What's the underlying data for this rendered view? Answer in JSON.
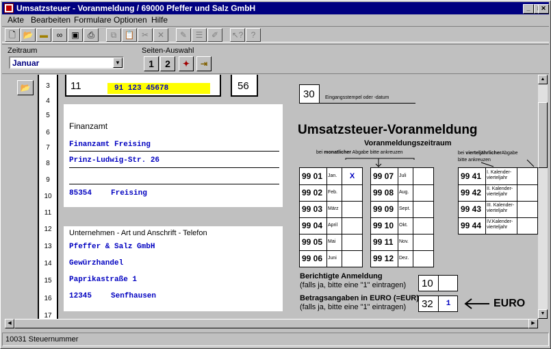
{
  "window": {
    "title": "Umsatzsteuer - Voranmeldung / 69000 Pfeffer und Salz GmbH",
    "min": "_",
    "max": "□",
    "close": "✕"
  },
  "menu": [
    "Akte",
    "Bearbeiten",
    "Formulare",
    "Optionen",
    "Hilfe"
  ],
  "toolbar_icons": [
    "new-icon",
    "open-icon",
    "folder-icon",
    "binoculars-icon",
    "save-icon",
    "print-icon",
    "copy-icon",
    "paste-icon",
    "cut-icon",
    "delete-icon",
    "document-icon",
    "list-icon",
    "notes-icon",
    "whats-this-icon",
    "help-icon"
  ],
  "zeitraum": {
    "label": "Zeitraum",
    "value": "Januar",
    "arrow": "▼"
  },
  "seiten": {
    "label": "Seiten-Auswahl",
    "b1": "1",
    "b2": "2"
  },
  "lines": [
    "3",
    "4",
    "5",
    "6",
    "7",
    "8",
    "9",
    "10",
    "11",
    "12",
    "13",
    "14",
    "15",
    "16",
    "17"
  ],
  "form": {
    "f11": "11",
    "steuernummer": "91 123 45678",
    "f56": "56",
    "f30": "30",
    "eingang": "Eingangsstempel oder -datum",
    "finanzamt_label": "Finanzamt",
    "finanzamt": "Finanzamt Freising",
    "strasse": "Prinz-Ludwig-Str. 26",
    "plz": "85354",
    "ort": "Freising",
    "unternehmen_label": "Unternehmen - Art und Anschrift - Telefon",
    "firma": "Pfeffer & Salz GmbH",
    "art": "Gewürzhandel",
    "u_strasse": "Paprikastraße 1",
    "u_plz": "12345",
    "u_ort": "Senfhausen",
    "title": "Umsatzsteuer-Voranmeldung",
    "subtitle": "Voranmeldungszeitraum",
    "monthly_note_a": "bei",
    "monthly_note_b": "monatlicher",
    "monthly_note_c": "Abgabe bitte ankreuzen",
    "quarter_note_a": "bei",
    "quarter_note_b": "vierteljährlicher",
    "quarter_note_c": "Abgabe",
    "quarter_note_d": "bitte ankreuzen",
    "months_left": [
      {
        "code": "99 01",
        "m": "Jan.",
        "x": "X"
      },
      {
        "code": "99 02",
        "m": "Feb.",
        "x": ""
      },
      {
        "code": "99 03",
        "m": "März",
        "x": ""
      },
      {
        "code": "99 04",
        "m": "April",
        "x": ""
      },
      {
        "code": "99 05",
        "m": "Mai",
        "x": ""
      },
      {
        "code": "99 06",
        "m": "Juni",
        "x": ""
      }
    ],
    "months_right": [
      {
        "code": "99 07",
        "m": "Juli",
        "x": ""
      },
      {
        "code": "99 08",
        "m": "Aug.",
        "x": ""
      },
      {
        "code": "99 09",
        "m": "Sept.",
        "x": ""
      },
      {
        "code": "99 10",
        "m": "Okt.",
        "x": ""
      },
      {
        "code": "99 11",
        "m": "Nov.",
        "x": ""
      },
      {
        "code": "99 12",
        "m": "Dez.",
        "x": ""
      }
    ],
    "quarters": [
      {
        "code": "99 41",
        "m": "I. Kalender-vierteljahr",
        "x": ""
      },
      {
        "code": "99 42",
        "m": "II. Kalender-vierteljahr",
        "x": ""
      },
      {
        "code": "99 43",
        "m": "III. Kalender-vierteljahr",
        "x": ""
      },
      {
        "code": "99 44",
        "m": "IV.Kalender-vierteljahr",
        "x": ""
      }
    ],
    "berichtigt_label": "Berichtigte Anmeldung",
    "berichtigt_hint": "(falls ja, bitte eine \"1\" eintragen)",
    "f10": "10",
    "f10_value": "",
    "euro_label": "Betragsangaben in EURO (=EUR)",
    "euro_hint": "(falls ja, bitte eine \"1\" eintragen)",
    "f32": "32",
    "f32_value": "1",
    "euro_marker": "EURO"
  },
  "status": "10031 Steuernummer"
}
